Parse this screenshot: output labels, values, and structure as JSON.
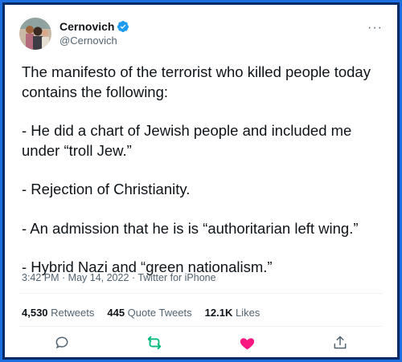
{
  "author": {
    "display_name": "Cernovich",
    "handle": "@Cernovich",
    "verified_icon": "verified-badge-icon",
    "accent": "#1d9bf0"
  },
  "tweet": {
    "lines": [
      "The manifesto of the terrorist who killed people today contains the following:",
      "- He did a chart of Jewish people and included me under “troll Jew.”",
      "- Rejection of Christianity.",
      "- An admission that he is is “authoritarian left wing.”",
      "- Hybrid Nazi and “green nationalism.”"
    ],
    "time": "3:42 PM",
    "separator1": " · ",
    "date": "May 14, 2022",
    "separator2": " · ",
    "source": "Twitter for iPhone"
  },
  "stats": {
    "retweets_count": "4,530",
    "retweets_label": " Retweets",
    "quotes_count": "445",
    "quotes_label": " Quote Tweets",
    "likes_count": "12.1K",
    "likes_label": " Likes"
  },
  "more_label": "···",
  "colors": {
    "retweet": "#00ba7c",
    "like": "#f91880",
    "muted": "#536471",
    "border_outer": "#1d6fe0",
    "border_inner": "#0a2a66"
  },
  "icons": [
    "reply-icon",
    "retweet-icon",
    "like-icon",
    "share-icon"
  ]
}
